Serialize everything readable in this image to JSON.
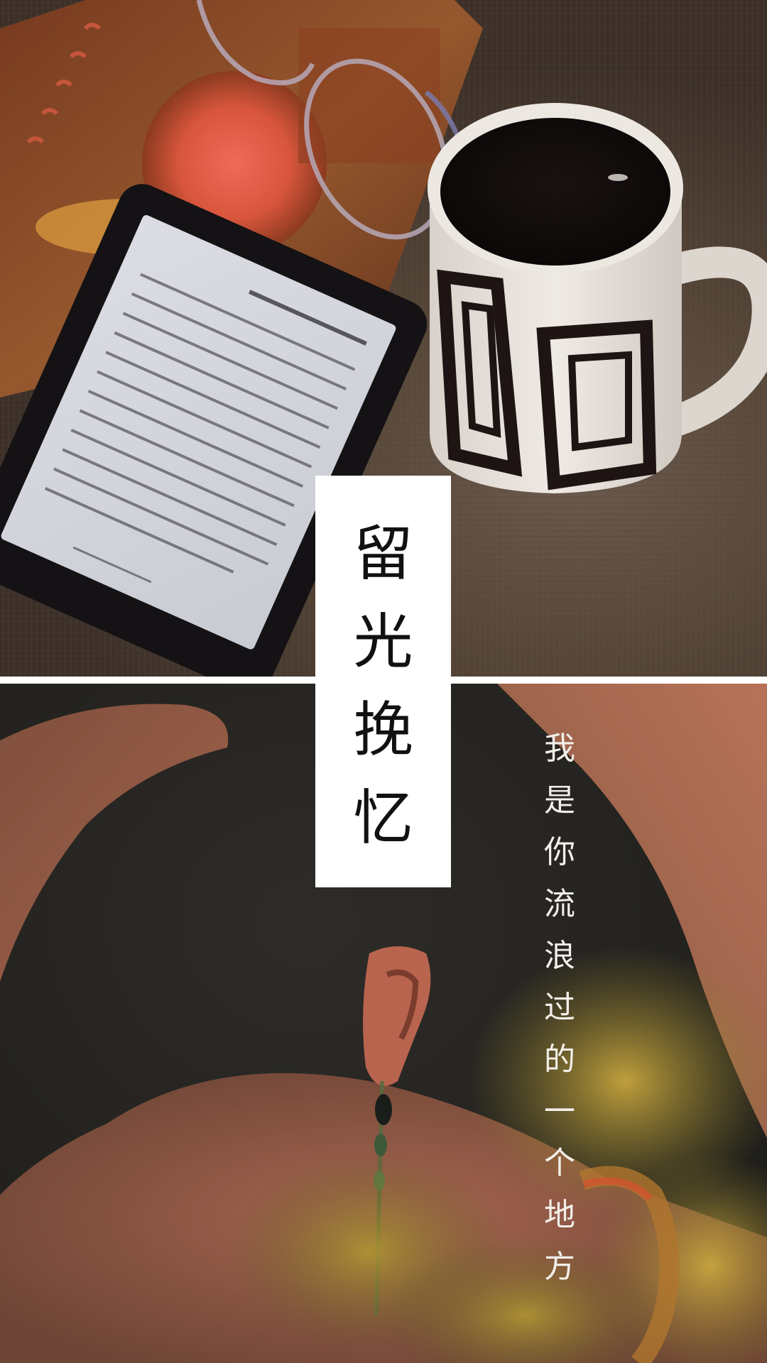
{
  "title": {
    "chars": [
      "留",
      "光",
      "挽",
      "忆"
    ]
  },
  "subtitle": {
    "chars": [
      "我",
      "是",
      "你",
      "流",
      "浪",
      "过",
      "的",
      "一",
      "个",
      "地",
      "方"
    ]
  },
  "photos": {
    "top": {
      "subject": "kindle-and-coffee-photo"
    },
    "bottom": {
      "subject": "woman-earring-photo"
    }
  },
  "colors": {
    "title_box": "#ffffff",
    "title_text": "#111111",
    "subtitle_text": "#f3efe9",
    "divider": "#ffffff"
  }
}
